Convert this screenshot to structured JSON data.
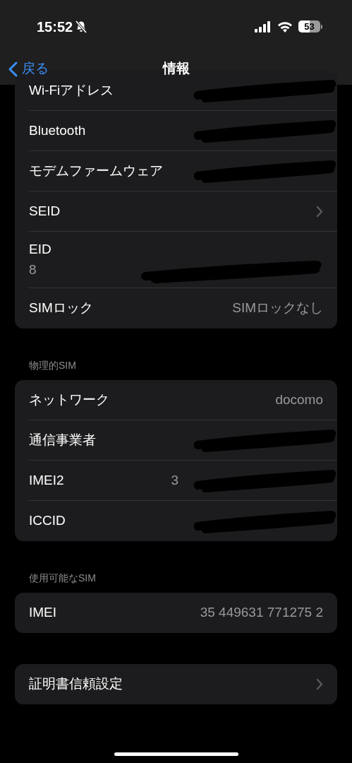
{
  "status_bar": {
    "time": "15:52",
    "silent": true,
    "battery": "53"
  },
  "nav": {
    "back": "戻る",
    "title": "情報"
  },
  "sections": [
    {
      "rows": [
        {
          "label": "Wi-Fiアドレス",
          "redacted": true,
          "chevron": false,
          "stacked": false
        },
        {
          "label": "Bluetooth",
          "redacted": true,
          "chevron": false,
          "stacked": false
        },
        {
          "label": "モデムファームウェア",
          "redacted": true,
          "chevron": false,
          "stacked": false
        },
        {
          "label": "SEID",
          "redacted": false,
          "chevron": true,
          "stacked": false
        },
        {
          "label": "EID",
          "value": "8",
          "redacted": true,
          "chevron": false,
          "stacked": true
        },
        {
          "label": "SIMロック",
          "value": "SIMロックなし",
          "redacted": false,
          "chevron": false,
          "stacked": false
        }
      ]
    },
    {
      "header": "物理的SIM",
      "rows": [
        {
          "label": "ネットワーク",
          "value": "docomo",
          "redacted": false,
          "chevron": false,
          "stacked": false
        },
        {
          "label": "通信事業者",
          "redacted": true,
          "chevron": false,
          "stacked": false
        },
        {
          "label": "IMEI2",
          "value": "3",
          "redacted": true,
          "chevron": false,
          "stacked": false
        },
        {
          "label": "ICCID",
          "redacted": true,
          "chevron": false,
          "stacked": false
        }
      ]
    },
    {
      "header": "使用可能なSIM",
      "rows": [
        {
          "label": "IMEI",
          "value": "35 449631 771275 2",
          "redacted": false,
          "chevron": false,
          "stacked": false
        }
      ]
    },
    {
      "rows": [
        {
          "label": "証明書信頼設定",
          "redacted": false,
          "chevron": true,
          "stacked": false
        }
      ]
    }
  ]
}
